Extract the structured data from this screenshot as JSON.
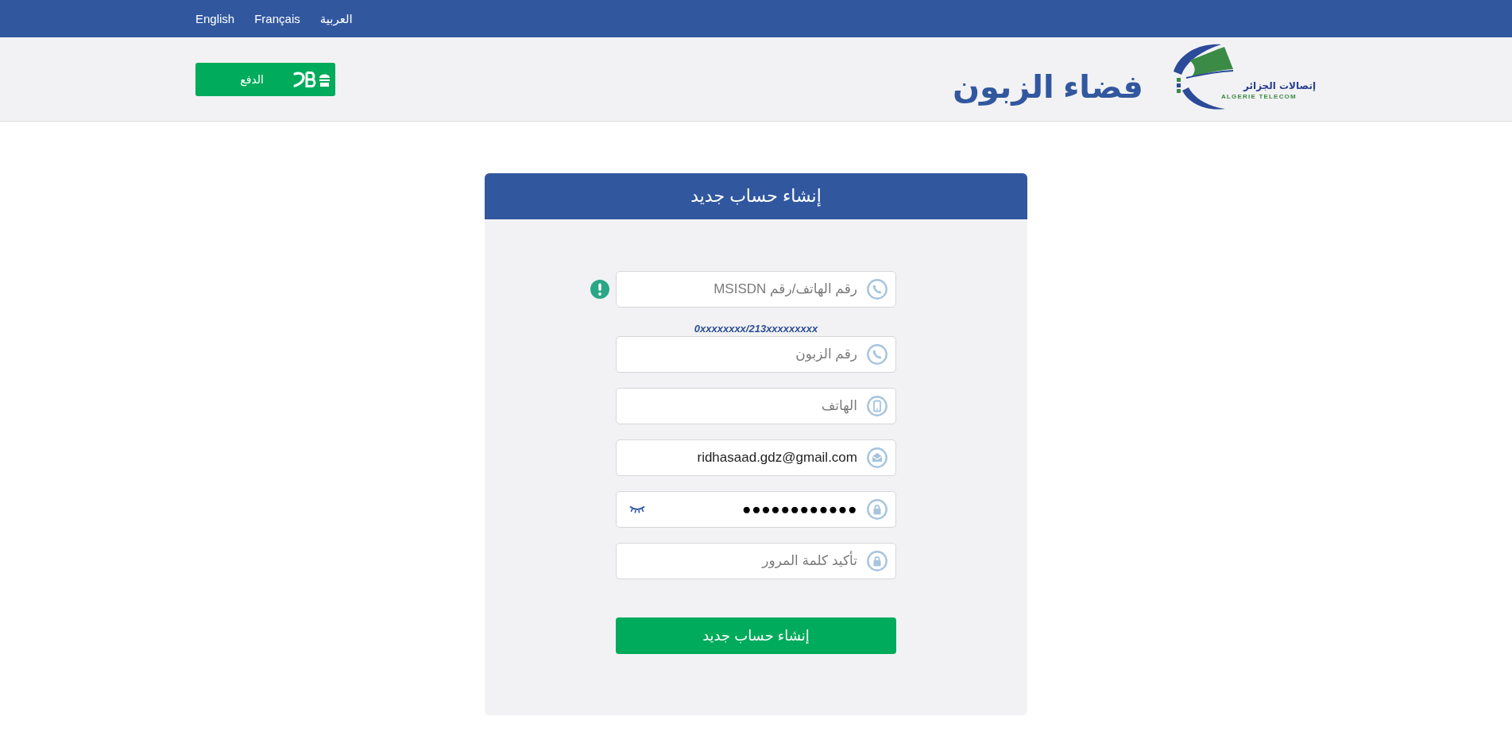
{
  "top_bar": {
    "languages": [
      "العربية",
      "Français",
      "English"
    ]
  },
  "header": {
    "logo": {
      "arabic": "إتصالات الجزائر",
      "latin": "ALGERIE TELECOM"
    },
    "title": "فضاء الزبون",
    "payment_button": {
      "label": "الدفع"
    }
  },
  "form": {
    "title": "إنشاء حساب جديد",
    "fields": [
      {
        "kind": "phone",
        "placeholder": "رقم الهاتف/رقم MSISDN",
        "warning": true,
        "eye_toggle": false,
        "hint": "0xxxxxxxx/213xxxxxxxxx"
      },
      {
        "kind": "phone",
        "placeholder": "رقم الزبون",
        "warning": false,
        "eye_toggle": false
      },
      {
        "kind": "mobile",
        "placeholder": "الهاتف",
        "warning": false,
        "eye_toggle": false
      },
      {
        "kind": "email",
        "value": "ridhasaad.gdz@gmail.com",
        "warning": false,
        "eye_toggle": false
      },
      {
        "kind": "lock",
        "value": "●●●●●●●●●●●●",
        "warning": false,
        "eye_toggle": true
      },
      {
        "kind": "lock",
        "placeholder": "تأكيد كلمة المرور",
        "warning": false,
        "eye_toggle": false
      }
    ],
    "submit": {
      "label": "إنشاء حساب جديد"
    }
  }
}
